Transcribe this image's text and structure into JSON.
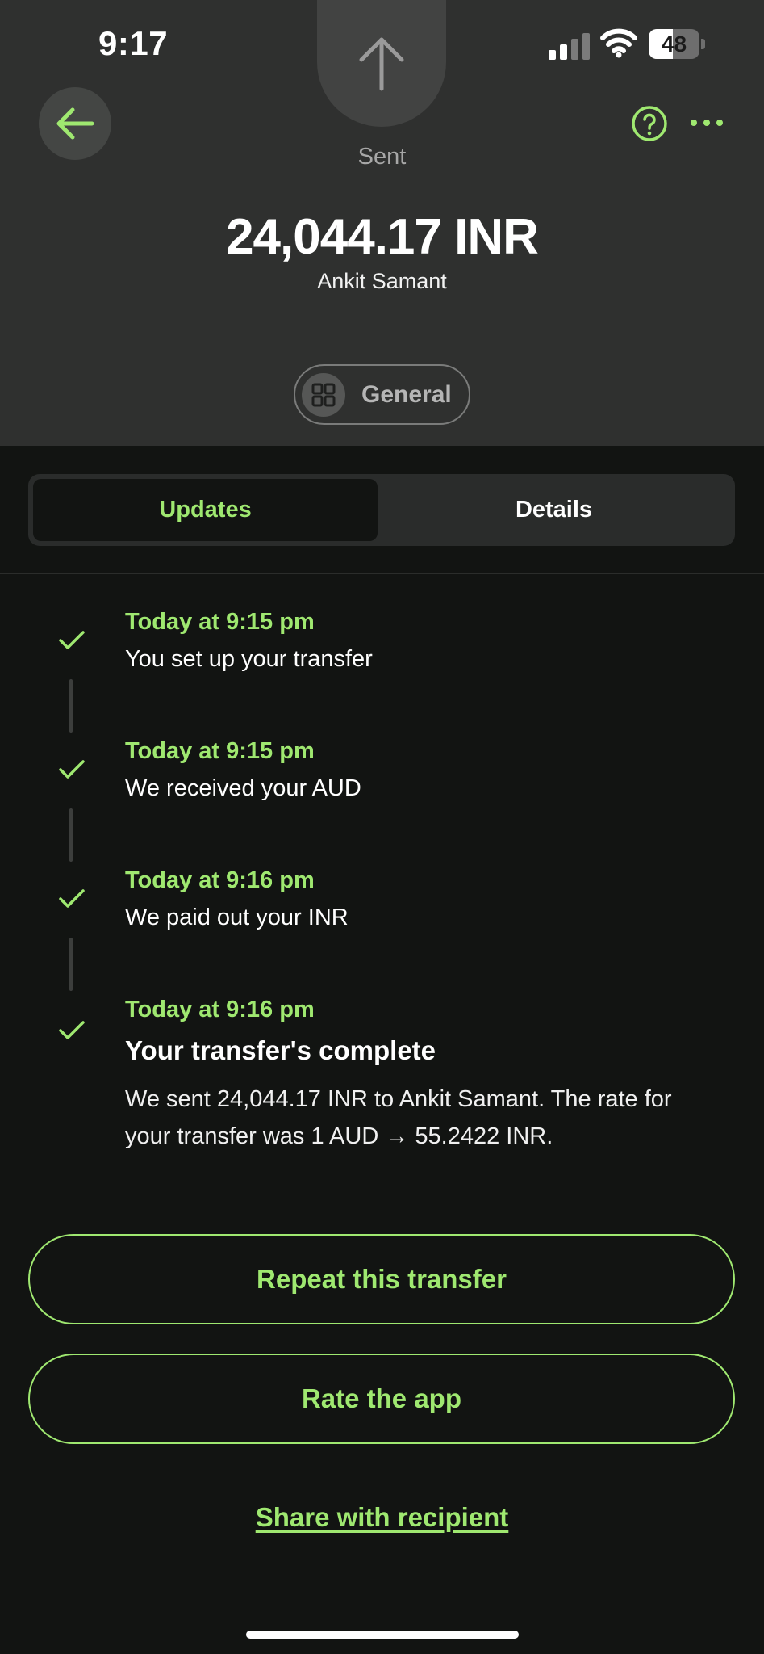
{
  "status_bar": {
    "time": "9:17",
    "battery_percent": "48",
    "battery_level": 0.48,
    "signal_bars": 4,
    "signal_active": 2
  },
  "header": {
    "sent_icon": "arrow-up-icon",
    "status_label": "Sent",
    "amount": "24,044.17 INR",
    "recipient": "Ankit Samant",
    "category": "General",
    "back_icon": "arrow-left-icon",
    "help_icon": "question-circle-icon",
    "more_icon": "ellipsis-icon"
  },
  "tabs": [
    {
      "label": "Updates",
      "active": true
    },
    {
      "label": "Details",
      "active": false
    }
  ],
  "timeline": [
    {
      "time": "Today at 9:15 pm",
      "text": "You set up your transfer"
    },
    {
      "time": "Today at 9:15 pm",
      "text": "We received your AUD"
    },
    {
      "time": "Today at 9:16 pm",
      "text": "We paid out your INR"
    },
    {
      "time": "Today at 9:16 pm",
      "title": "Your transfer's complete",
      "desc_line1": "We sent 24,044.17 INR to Ankit Samant. The rate for",
      "desc_line2": "your transfer was 1 AUD → 55.2422 INR."
    }
  ],
  "actions": {
    "repeat_label": "Repeat this transfer",
    "rate_label": "Rate the app",
    "share_label": "Share with recipient"
  },
  "colors": {
    "accent": "#9fe870",
    "header_bg": "#2f302f",
    "page_bg": "#121412"
  }
}
